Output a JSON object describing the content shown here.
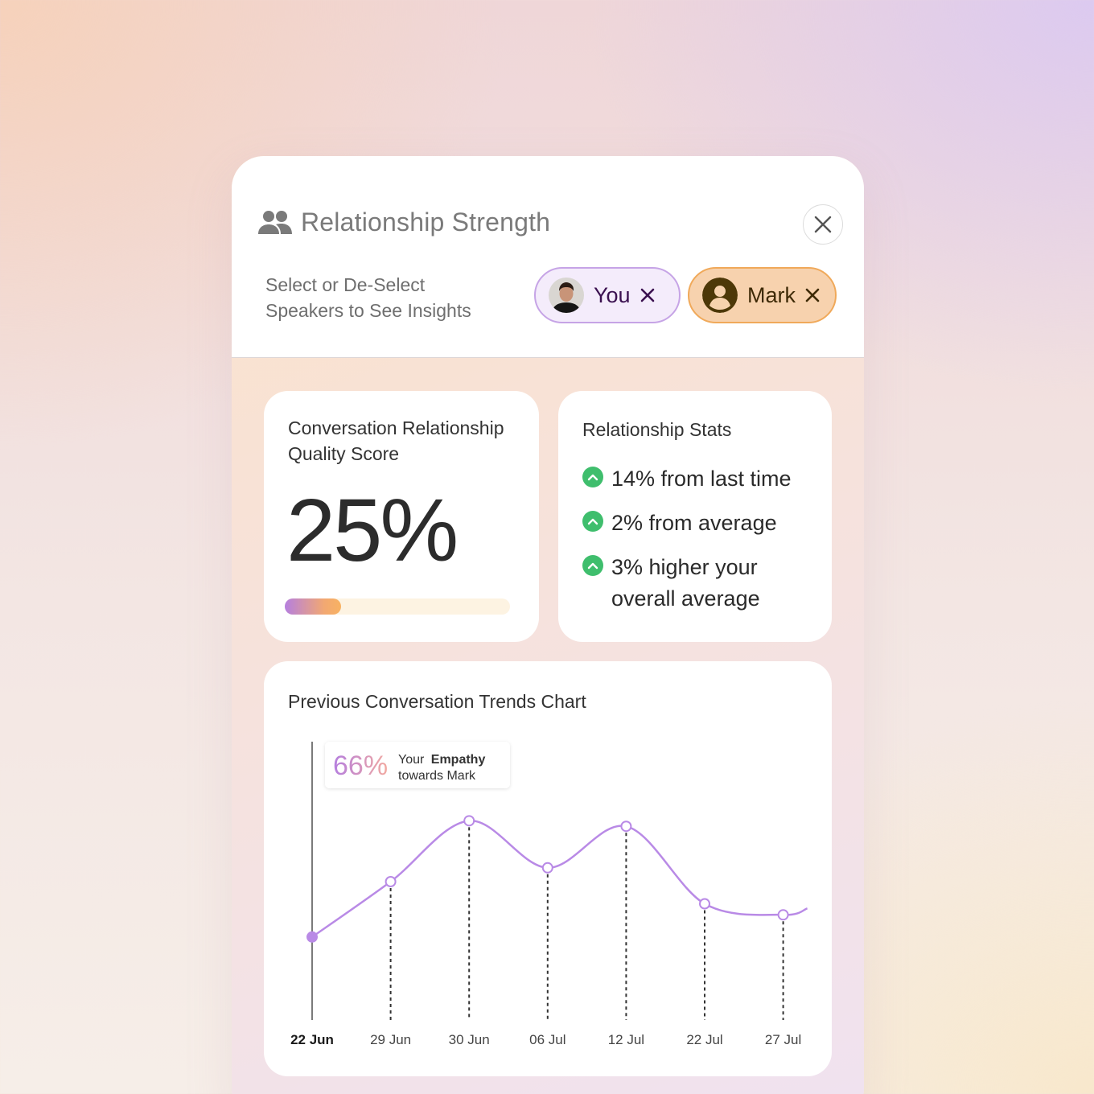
{
  "header": {
    "title": "Relationship Strength",
    "subtitle": "Select or De-Select Speakers to See Insights",
    "title_icon": "people-icon",
    "close_icon": "close-icon"
  },
  "speakers": [
    {
      "label": "You",
      "avatar": "user-photo",
      "remove_icon": "close-icon",
      "accent": "#c6a4e6"
    },
    {
      "label": "Mark",
      "avatar": "person-icon",
      "remove_icon": "close-icon",
      "accent": "#f0a95a"
    }
  ],
  "score_card": {
    "title": "Conversation Relationship Quality Score",
    "value": "25%",
    "progress": 0.25
  },
  "stats_card": {
    "title": "Relationship Stats",
    "items": [
      {
        "text": "14% from last time",
        "icon": "chevron-up-icon"
      },
      {
        "text": "2% from average",
        "icon": "chevron-up-icon"
      },
      {
        "text": "3% higher your overall average",
        "icon": "chevron-up-icon"
      }
    ],
    "positive_color": "#3fbe6d"
  },
  "trend_card": {
    "title": "Previous Conversation Trends Chart"
  },
  "chart_data": {
    "type": "line",
    "title": "Previous Conversation Trends Chart",
    "categories": [
      "22 Jun",
      "29 Jun",
      "30 Jun",
      "06 Jul",
      "12 Jul",
      "22 Jul",
      "27 Jul"
    ],
    "series": [
      {
        "values": [
          30,
          50,
          72,
          55,
          70,
          42,
          38
        ]
      }
    ],
    "selected_index": 0,
    "line_color": "#b98ae6",
    "tooltip": {
      "value": "66%",
      "prefix": "Your",
      "metric": "Empathy",
      "suffix": "towards Mark"
    },
    "ylim": [
      0,
      100
    ]
  }
}
